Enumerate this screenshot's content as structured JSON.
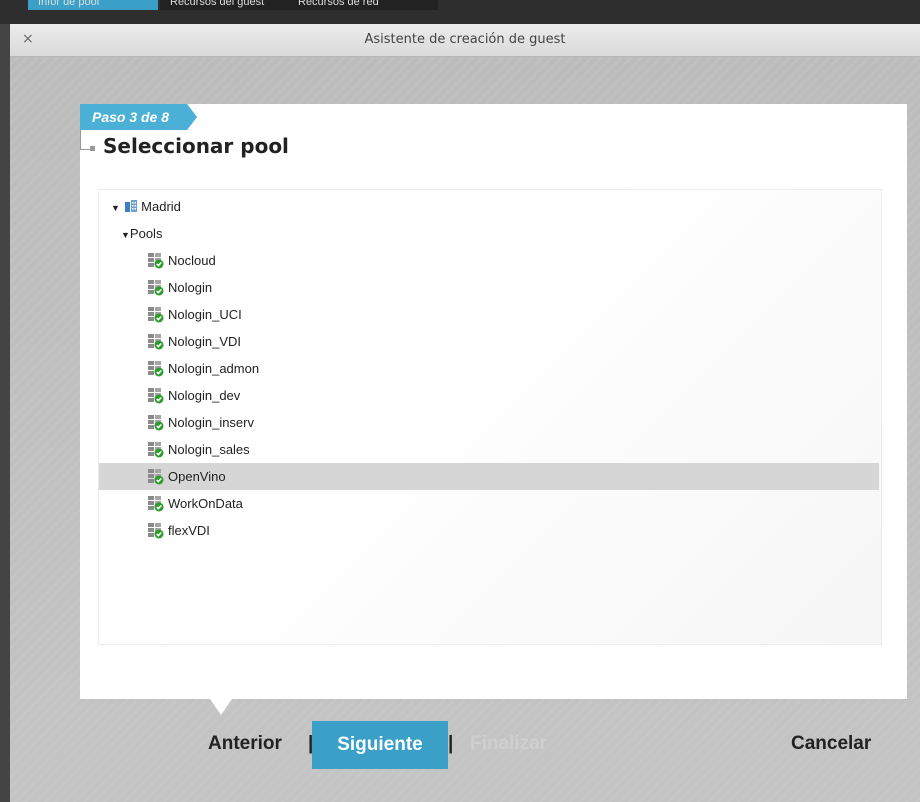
{
  "top_tabs": [
    "Infor de pool",
    "Recursos del guest",
    "Recursos de red"
  ],
  "window": {
    "title": "Asistente de creación de guest",
    "close_glyph": "×"
  },
  "step": {
    "label": "Paso 3 de 8",
    "title": "Seleccionar pool"
  },
  "tree": {
    "datacenter": {
      "label": "Madrid",
      "icon": "datacenter-icon",
      "expanded": true
    },
    "group": {
      "label": "Pools",
      "expanded": true
    },
    "pools": [
      {
        "label": "Nocloud",
        "icon": "pool-icon",
        "selected": false
      },
      {
        "label": "Nologin",
        "icon": "pool-icon",
        "selected": false
      },
      {
        "label": "Nologin_UCI",
        "icon": "pool-icon",
        "selected": false
      },
      {
        "label": "Nologin_VDI",
        "icon": "pool-icon",
        "selected": false
      },
      {
        "label": "Nologin_admon",
        "icon": "pool-icon",
        "selected": false
      },
      {
        "label": "Nologin_dev",
        "icon": "pool-icon",
        "selected": false
      },
      {
        "label": "Nologin_inserv",
        "icon": "pool-icon",
        "selected": false
      },
      {
        "label": "Nologin_sales",
        "icon": "pool-icon",
        "selected": false
      },
      {
        "label": "OpenVino",
        "icon": "pool-icon",
        "selected": true
      },
      {
        "label": "WorkOnData",
        "icon": "pool-icon",
        "selected": false
      },
      {
        "label": "flexVDI",
        "icon": "pool-icon",
        "selected": false
      }
    ]
  },
  "buttons": {
    "previous": "Anterior",
    "next": "Siguiente",
    "finish": "Finalizar",
    "cancel": "Cancelar",
    "separator": "|"
  },
  "colors": {
    "accent": "#3aa0c8",
    "step_tag": "#4ab0d6",
    "selected_row": "#d6d6d6",
    "pool_check": "#2e9b2e"
  }
}
